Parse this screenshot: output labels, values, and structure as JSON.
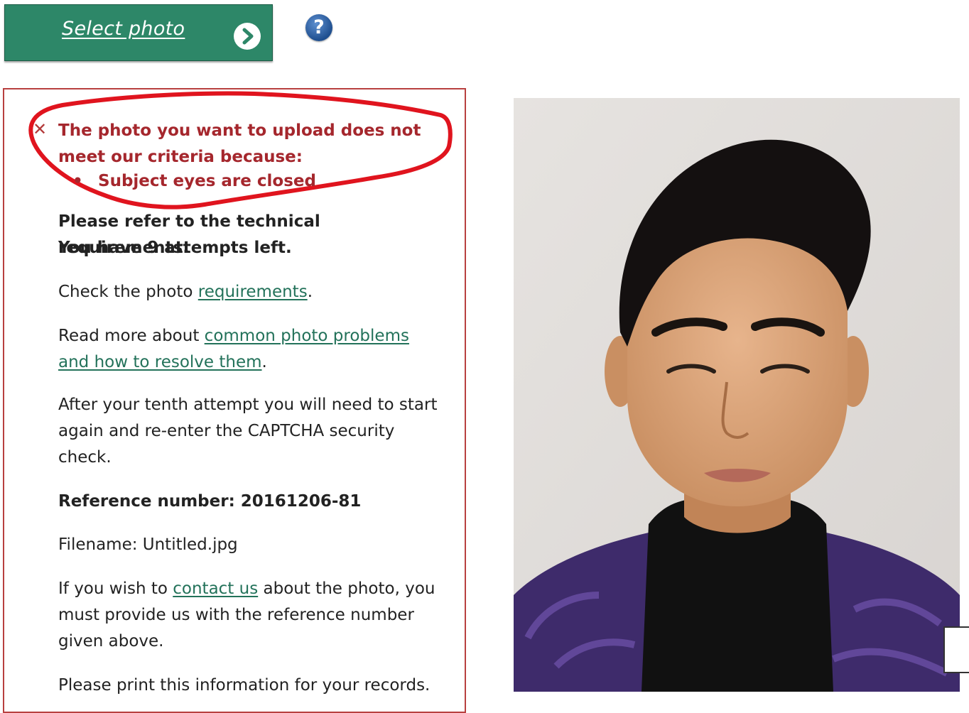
{
  "toolbar": {
    "select_label": "Select photo",
    "help_glyph": "?",
    "icons": {
      "next": "chevron-right-icon",
      "help": "question-icon"
    }
  },
  "error": {
    "icon": "close-icon",
    "title": "The photo you want to upload does not meet our criteria because:",
    "reasons": [
      "Subject eyes are closed"
    ],
    "color": "#a5272d"
  },
  "info": {
    "refer": "Please refer to the technical requirements.",
    "attempts": "You have 9 attempts left.",
    "check_prefix": "Check the photo ",
    "check_link": "requirements",
    "check_suffix": ".",
    "read_prefix": "Read more about ",
    "read_link": "common photo problems and how to resolve them",
    "read_suffix": ".",
    "tenth": "After your tenth attempt you will need to start again and re-enter the CAPTCHA security check.",
    "reference": "Reference number: 20161206-81",
    "filename": "Filename: Untitled.jpg",
    "contact_prefix": "If you wish to ",
    "contact_link": "contact us",
    "contact_suffix": " about the photo, you must provide us with the reference number given above.",
    "print": "Please print this information for your records."
  },
  "colors": {
    "button": "#2d8768",
    "link": "#23725a",
    "panel_border": "#b8403f",
    "annotation": "#e0141e"
  }
}
